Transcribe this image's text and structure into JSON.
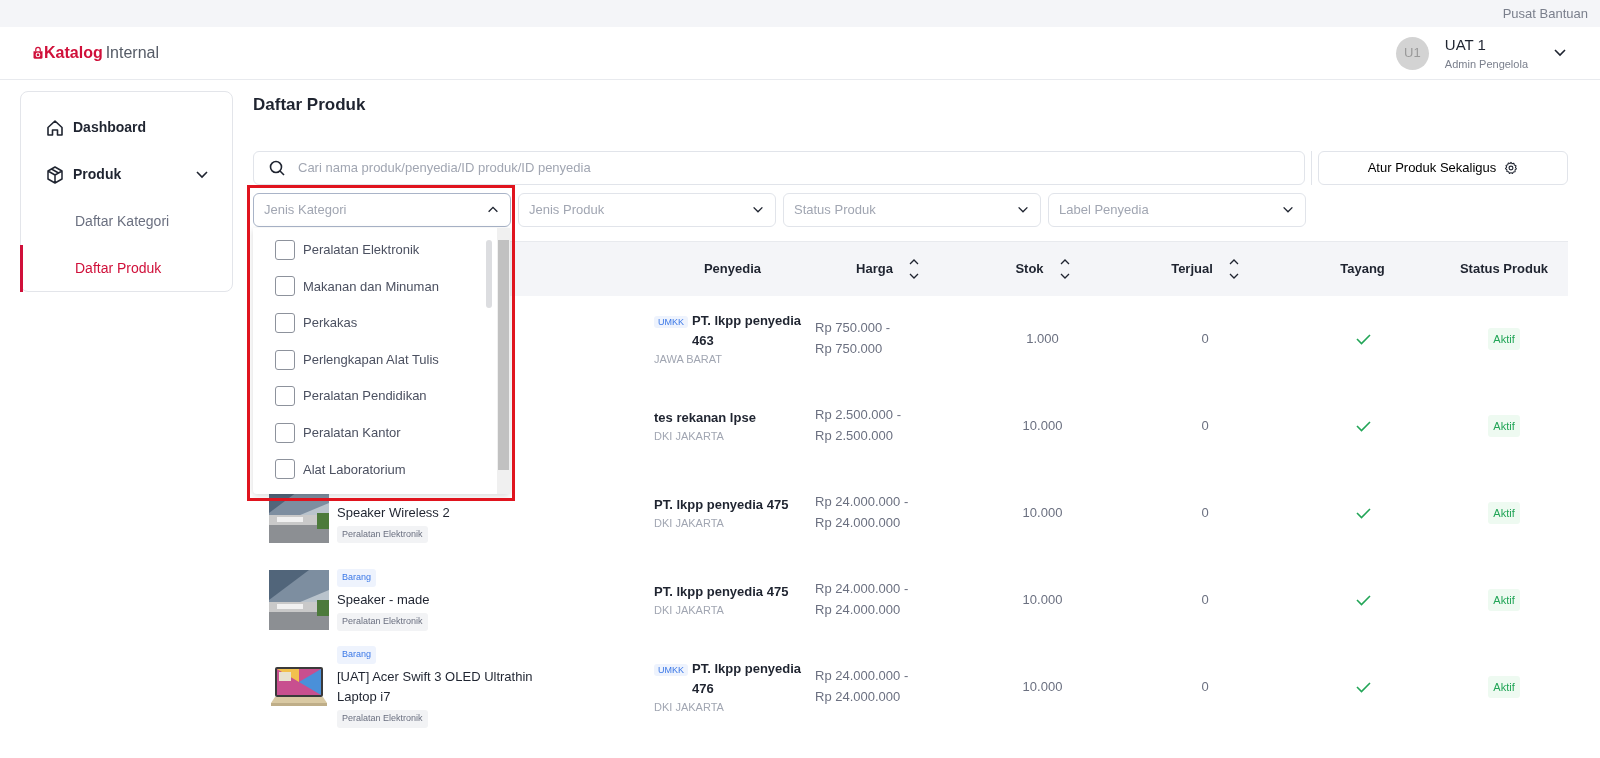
{
  "top_bar": {
    "help_link": "Pusat Bantuan"
  },
  "header": {
    "logo_main": "Katalog",
    "logo_suffix": "Internal",
    "user": {
      "initials": "U1",
      "name": "UAT 1",
      "role": "Admin Pengelola"
    }
  },
  "sidebar": {
    "items": [
      {
        "label": "Dashboard",
        "kind": "home",
        "selected": false
      },
      {
        "label": "Produk",
        "kind": "box",
        "selected": false,
        "expanded": true,
        "children": [
          {
            "label": "Daftar Kategori",
            "selected": false
          },
          {
            "label": "Daftar Produk",
            "selected": true
          }
        ]
      }
    ]
  },
  "page": {
    "title": "Daftar Produk"
  },
  "search": {
    "placeholder": "Cari nama produk/penyedia/ID produk/ID penyedia"
  },
  "bulk_button": {
    "label": "Atur Produk Sekaligus"
  },
  "filters": [
    {
      "placeholder": "Jenis Kategori",
      "open": true
    },
    {
      "placeholder": "Jenis Produk",
      "open": false
    },
    {
      "placeholder": "Status Produk",
      "open": false
    },
    {
      "placeholder": "Label Penyedia",
      "open": false
    }
  ],
  "category_options": [
    {
      "label": "Peralatan Elektronik",
      "checked": false
    },
    {
      "label": "Makanan dan Minuman",
      "checked": false
    },
    {
      "label": "Perkakas",
      "checked": false
    },
    {
      "label": "Perlengkapan Alat Tulis",
      "checked": false
    },
    {
      "label": "Peralatan Pendidikan",
      "checked": false
    },
    {
      "label": "Peralatan Kantor",
      "checked": false
    },
    {
      "label": "Alat Laboratorium",
      "checked": false
    }
  ],
  "table": {
    "columns": [
      {
        "label": "Penyedia"
      },
      {
        "label": "Harga",
        "sortable": true
      },
      {
        "label": "Stok",
        "sortable": true
      },
      {
        "label": "Terjual",
        "sortable": true
      },
      {
        "label": "Tayang"
      },
      {
        "label": "Status Produk"
      }
    ],
    "rows": [
      {
        "badge": "UMKK",
        "vendor": "PT. lkpp penyedia 463",
        "region": "JAWA BARAT",
        "price_from": "Rp 750.000 -",
        "price_to": "Rp 750.000",
        "stock": "1.000",
        "sold": "0",
        "live": true,
        "status": "Aktif"
      },
      {
        "vendor": "tes rekanan lpse",
        "region": "DKI JAKARTA",
        "price_from": "Rp 2.500.000 -",
        "price_to": "Rp 2.500.000",
        "stock": "10.000",
        "sold": "0",
        "live": true,
        "status": "Aktif"
      },
      {
        "product": {
          "name": "Speaker Wireless 2",
          "category": "Peralatan Elektronik"
        },
        "vendor": "PT. lkpp penyedia 475",
        "region": "DKI JAKARTA",
        "price_from": "Rp 24.000.000 -",
        "price_to": "Rp 24.000.000",
        "stock": "10.000",
        "sold": "0",
        "live": true,
        "status": "Aktif"
      },
      {
        "product": {
          "type": "Barang",
          "name": "Speaker - made",
          "category": "Peralatan Elektronik"
        },
        "vendor": "PT. lkpp penyedia 475",
        "region": "DKI JAKARTA",
        "price_from": "Rp 24.000.000 -",
        "price_to": "Rp 24.000.000",
        "stock": "10.000",
        "sold": "0",
        "live": true,
        "status": "Aktif"
      },
      {
        "product": {
          "type": "Barang",
          "name": "[UAT] Acer Swift 3 OLED Ultrathin Laptop i7",
          "category": "Peralatan Elektronik"
        },
        "badge": "UMKK",
        "vendor": "PT. lkpp penyedia 476",
        "region": "DKI JAKARTA",
        "price_from": "Rp 24.000.000 -",
        "price_to": "Rp 24.000.000",
        "stock": "10.000",
        "sold": "0",
        "live": true,
        "status": "Aktif"
      }
    ]
  }
}
